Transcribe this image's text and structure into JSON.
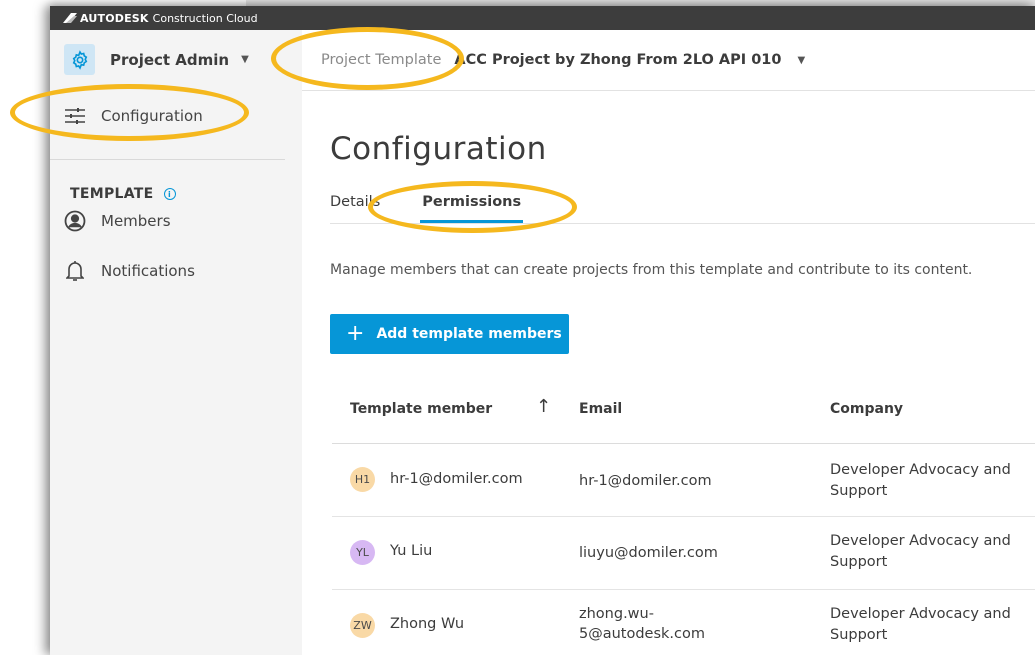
{
  "topbar": {
    "brand": "AUTODESK",
    "product": "Construction Cloud"
  },
  "sidebar": {
    "title": "Project Admin",
    "config_label": "Configuration",
    "section_label": "TEMPLATE",
    "members_label": "Members",
    "notifications_label": "Notifications"
  },
  "header": {
    "breadcrumb_parent": "Project Template",
    "breadcrumb_current": "ACC Project by Zhong From 2LO API 010"
  },
  "main": {
    "title": "Configuration",
    "tabs": [
      {
        "label": "Details"
      },
      {
        "label": "Permissions"
      }
    ],
    "description": "Manage members that can create projects from this template and contribute to its content.",
    "add_button": "Add template members"
  },
  "table": {
    "columns": [
      "Template member",
      "Email",
      "Company"
    ],
    "rows": [
      {
        "initials": "H1",
        "avatar_color": "#f9d9a6",
        "name": "hr-1@domiler.com",
        "email_1": "hr-1@domiler.com",
        "email_2": "",
        "company_1": "Developer Advocacy and",
        "company_2": "Support"
      },
      {
        "initials": "YL",
        "avatar_color": "#d7b8f3",
        "name": "Yu Liu",
        "email_1": "liuyu@domiler.com",
        "email_2": "",
        "company_1": "Developer Advocacy and",
        "company_2": "Support"
      },
      {
        "initials": "ZW",
        "avatar_color": "#f9d9a6",
        "name": "Zhong Wu",
        "email_1": "zhong.wu-",
        "email_2": "5@autodesk.com",
        "company_1": "Developer Advocacy and",
        "company_2": "Support"
      }
    ]
  },
  "colors": {
    "accent": "#0696d7",
    "highlight": "#f5b81e",
    "topbar": "#3d3d3d"
  }
}
